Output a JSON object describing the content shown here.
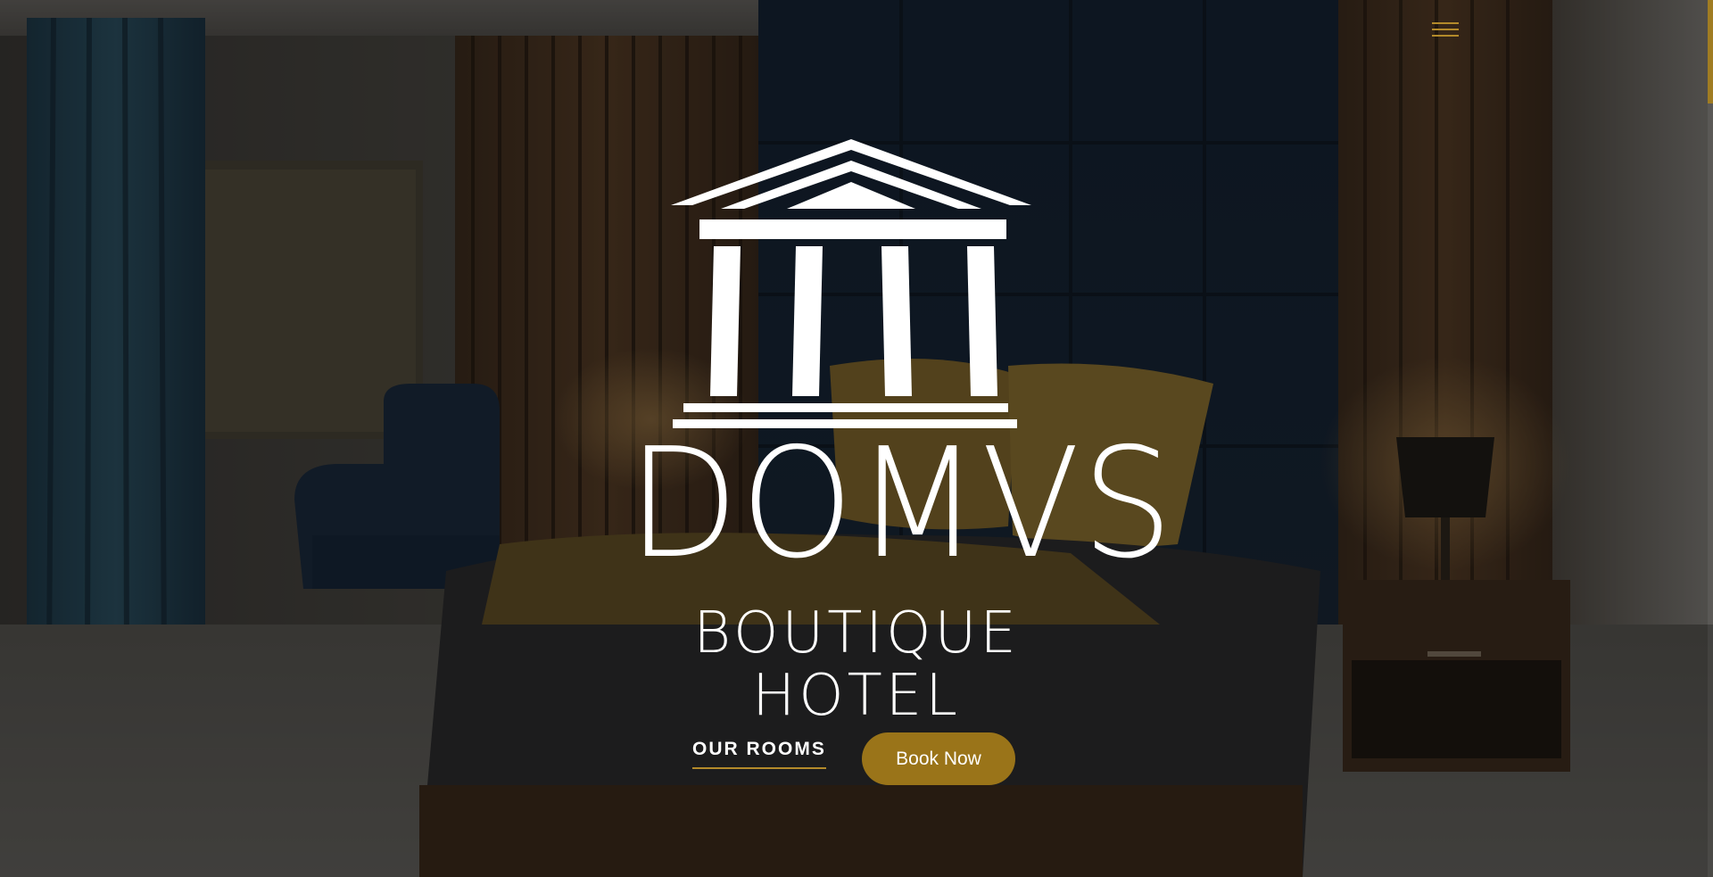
{
  "hero": {
    "brand_name": "DOMVS",
    "brand_subtitle": "BOUTIQUE HOTEL"
  },
  "menu": {
    "icon": "hamburger-menu-icon",
    "accent_color": "#b38a2a"
  },
  "cta": {
    "rooms_label": "OUR ROOMS",
    "book_label": "Book Now",
    "book_color": "#9a7419"
  },
  "logo": {
    "icon": "temple-pillars-icon"
  }
}
